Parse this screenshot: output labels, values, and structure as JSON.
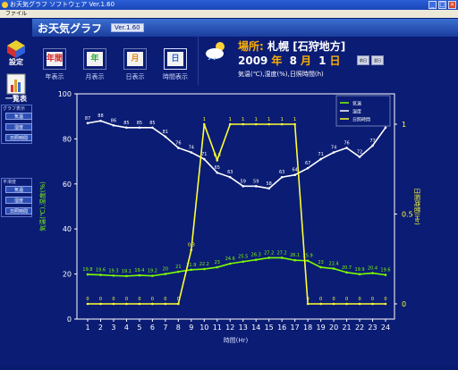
{
  "window": {
    "title": "お天気グラフ ソフトウェア Ver.1.60",
    "menu": [
      "ファイル"
    ]
  },
  "header": {
    "logo": "お天気グラフ",
    "version": "Ver.1.60"
  },
  "sidebar": {
    "settings_label": "設定",
    "list_label": "一覧表",
    "graph_section_title": "グラフ表示",
    "graph_buttons": [
      "気温",
      "湿度",
      "日照時間"
    ],
    "smooth_section_title": "平滑度",
    "smooth_buttons": [
      "気温",
      "湿度",
      "日照時間"
    ]
  },
  "views": [
    {
      "label": "年表示",
      "icon": "年間",
      "color": "#d81f1f"
    },
    {
      "label": "月表示",
      "icon": "年",
      "color": "#2fa83a"
    },
    {
      "label": "日表示",
      "icon": "月",
      "color": "#e08a10"
    },
    {
      "label": "時間表示",
      "icon": "日",
      "color": "#2a64d8",
      "selected": true
    }
  ],
  "location": {
    "prefix": "場所",
    "name": "札幌",
    "region": "[石狩地方]"
  },
  "date": {
    "year": "2009",
    "year_unit": "年",
    "month": "8",
    "month_unit": "月",
    "day": "1",
    "day_unit": "日"
  },
  "nav": {
    "prev": "前日",
    "next": "翌日"
  },
  "series_caption": "気温(℃),湿度(%),日照時間(h)",
  "chart_data": {
    "type": "line",
    "xlabel": "時間(Hr)",
    "ylabel_left": "気温(℃),湿度(%)",
    "ylabel_right": "日照時間(Hr)",
    "x": [
      1,
      2,
      3,
      4,
      5,
      6,
      7,
      8,
      9,
      10,
      11,
      12,
      13,
      14,
      15,
      16,
      17,
      18,
      19,
      20,
      21,
      22,
      23,
      24
    ],
    "ylim_left": [
      0,
      100
    ],
    "yticks_left": [
      0,
      20,
      40,
      60,
      80,
      100
    ],
    "ylim_right": [
      0,
      1.2
    ],
    "yticks_right": [
      "0",
      "0.5",
      "1"
    ],
    "grid": false,
    "legend": "top-right",
    "series": [
      {
        "name": "気温",
        "color": "#7CFC00",
        "axis": "left",
        "values": [
          19.8,
          19.6,
          19.3,
          19.1,
          19.4,
          19.2,
          20.0,
          21.0,
          21.9,
          22.2,
          23.0,
          24.6,
          25.5,
          26.3,
          27.2,
          27.2,
          26.1,
          25.9,
          23.0,
          22.4,
          20.7,
          19.9,
          20.4,
          19.6
        ],
        "labels": [
          "19.8",
          "19.6",
          "19.3",
          "19.1",
          "19.4",
          "19.2",
          "20",
          "21",
          "21.9",
          "22.2",
          "23",
          "24.6",
          "25.5",
          "26.3",
          "27.2",
          "27.2",
          "26.1",
          "25.9",
          "23",
          "22.4",
          "20.7",
          "19.9",
          "20.4",
          "19.6"
        ]
      },
      {
        "name": "湿度",
        "color": "#ffffff",
        "axis": "left",
        "values": [
          87,
          88,
          86,
          85,
          85,
          85,
          81,
          76,
          74,
          71,
          65,
          63,
          59,
          59,
          58,
          63,
          64,
          67,
          71,
          74,
          76,
          72,
          77,
          85
        ],
        "labels": [
          "87",
          "88",
          "86",
          "85",
          "85",
          "85",
          "81",
          "76",
          "74",
          "71",
          "65",
          "63",
          "59",
          "59",
          "58",
          "63",
          "64",
          "67",
          "71",
          "74",
          "76",
          "72",
          "77",
          "85"
        ]
      },
      {
        "name": "日照時間",
        "color": "#ffff33",
        "axis": "right",
        "values": [
          0,
          0,
          0,
          0,
          0,
          0,
          0,
          0,
          0.3,
          1,
          0.8,
          1,
          1,
          1,
          1,
          1,
          1,
          0,
          0,
          0,
          0,
          0,
          0,
          0
        ],
        "labels": [
          "0",
          "0",
          "0",
          "0",
          "0",
          "0",
          "0",
          "0",
          "0.3",
          "1",
          "0.8",
          "1",
          "1",
          "1",
          "1",
          "1",
          "1",
          "0",
          "0",
          "0",
          "0",
          "0",
          "0",
          "0"
        ]
      }
    ]
  }
}
